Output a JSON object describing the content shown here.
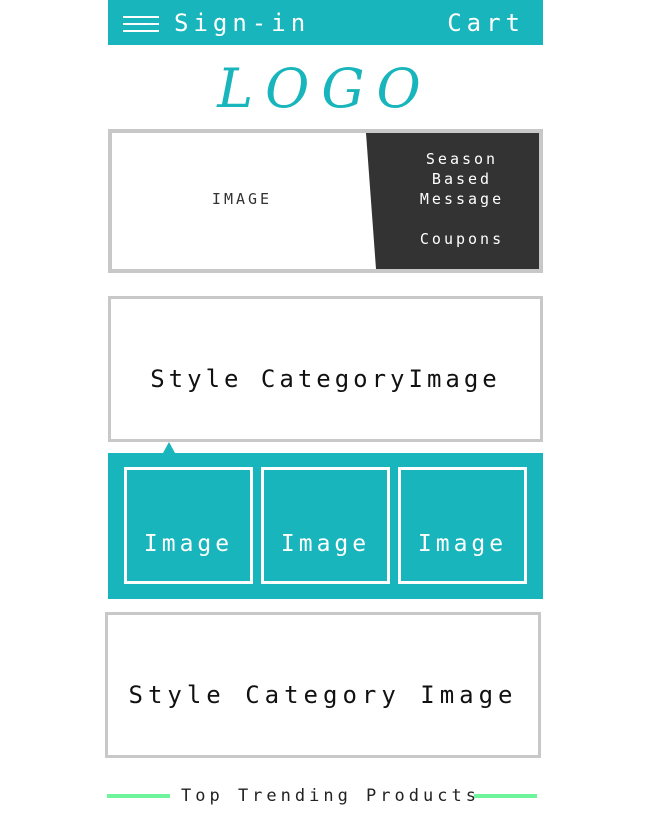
{
  "header": {
    "menu_icon": "hamburger-icon",
    "sign_in": "Sign-in",
    "cart": "Cart",
    "background": "#19b5bc"
  },
  "logo": {
    "text": "LOGO",
    "color": "#19b5bc"
  },
  "hero": {
    "image_label": "IMAGE",
    "promo": {
      "line1": "Season",
      "line2": "Based",
      "line3": "Message",
      "line4": "Coupons",
      "background": "#333333"
    }
  },
  "categories": [
    {
      "label": "Style CategoryImage"
    },
    {
      "label": "Style Category Image"
    }
  ],
  "image_strip": {
    "background": "#19b5bc",
    "tiles": [
      {
        "label": "Image"
      },
      {
        "label": "Image"
      },
      {
        "label": "Image"
      }
    ]
  },
  "trending": {
    "title": "Top Trending Products",
    "accent": "#6ef59b"
  }
}
